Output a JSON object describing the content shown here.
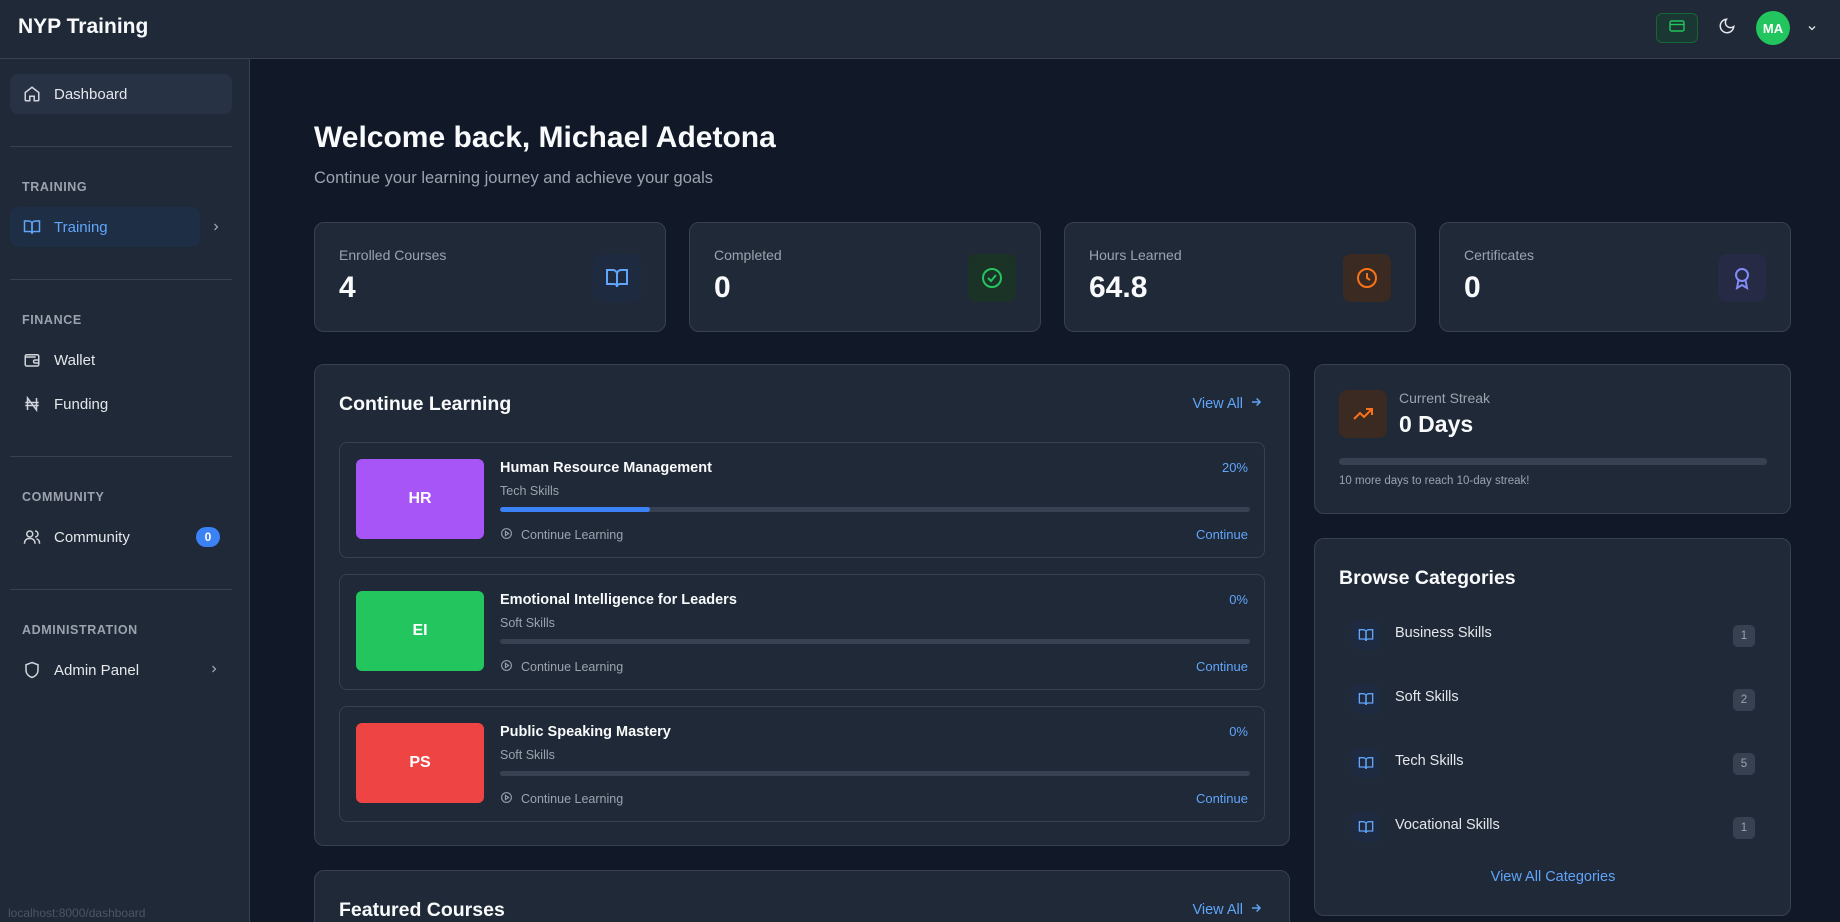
{
  "app": {
    "brand": "NYP Training"
  },
  "header": {
    "avatar_initials": "MA"
  },
  "sidebar": {
    "dashboard": "Dashboard",
    "sections": {
      "training": "TRAINING",
      "finance": "FINANCE",
      "community": "COMMUNITY",
      "administration": "ADMINISTRATION"
    },
    "items": {
      "training": "Training",
      "wallet": "Wallet",
      "funding": "Funding",
      "community": "Community",
      "community_badge": "0",
      "admin_panel": "Admin Panel"
    },
    "status_url": "localhost:8000/dashboard"
  },
  "main": {
    "welcome": "Welcome back, Michael Adetona",
    "subtitle": "Continue your learning journey and achieve your goals",
    "stats": [
      {
        "label": "Enrolled Courses",
        "value": "4",
        "icon": "book-open-icon",
        "color": "#60a5fa"
      },
      {
        "label": "Completed",
        "value": "0",
        "icon": "check-circle-icon",
        "color": "#22c55e"
      },
      {
        "label": "Hours Learned",
        "value": "64.8",
        "icon": "clock-icon",
        "color": "#f97316"
      },
      {
        "label": "Certificates",
        "value": "0",
        "icon": "award-icon",
        "color": "#818cf8"
      }
    ],
    "continue_learning": {
      "title": "Continue Learning",
      "view_all": "View All",
      "courses": [
        {
          "initials": "HR",
          "title": "Human Resource Management",
          "category": "Tech Skills",
          "percent_label": "20%",
          "progress": 20,
          "color": "#a855f7",
          "status": "Continue Learning",
          "action": "Continue"
        },
        {
          "initials": "EI",
          "title": "Emotional Intelligence for Leaders",
          "category": "Soft Skills",
          "percent_label": "0%",
          "progress": 0,
          "color": "#22c55e",
          "status": "Continue Learning",
          "action": "Continue"
        },
        {
          "initials": "PS",
          "title": "Public Speaking Mastery",
          "category": "Soft Skills",
          "percent_label": "0%",
          "progress": 0,
          "color": "#ef4444",
          "status": "Continue Learning",
          "action": "Continue"
        }
      ]
    },
    "featured": {
      "title": "Featured Courses",
      "view_all": "View All"
    },
    "streak": {
      "label": "Current Streak",
      "value": "0 Days",
      "progress": 0,
      "note": "10 more days to reach 10-day streak!"
    },
    "categories": {
      "title": "Browse Categories",
      "items": [
        {
          "label": "Business Skills",
          "count": "1"
        },
        {
          "label": "Soft Skills",
          "count": "2"
        },
        {
          "label": "Tech Skills",
          "count": "5"
        },
        {
          "label": "Vocational Skills",
          "count": "1"
        }
      ],
      "view_all": "View All Categories"
    }
  }
}
